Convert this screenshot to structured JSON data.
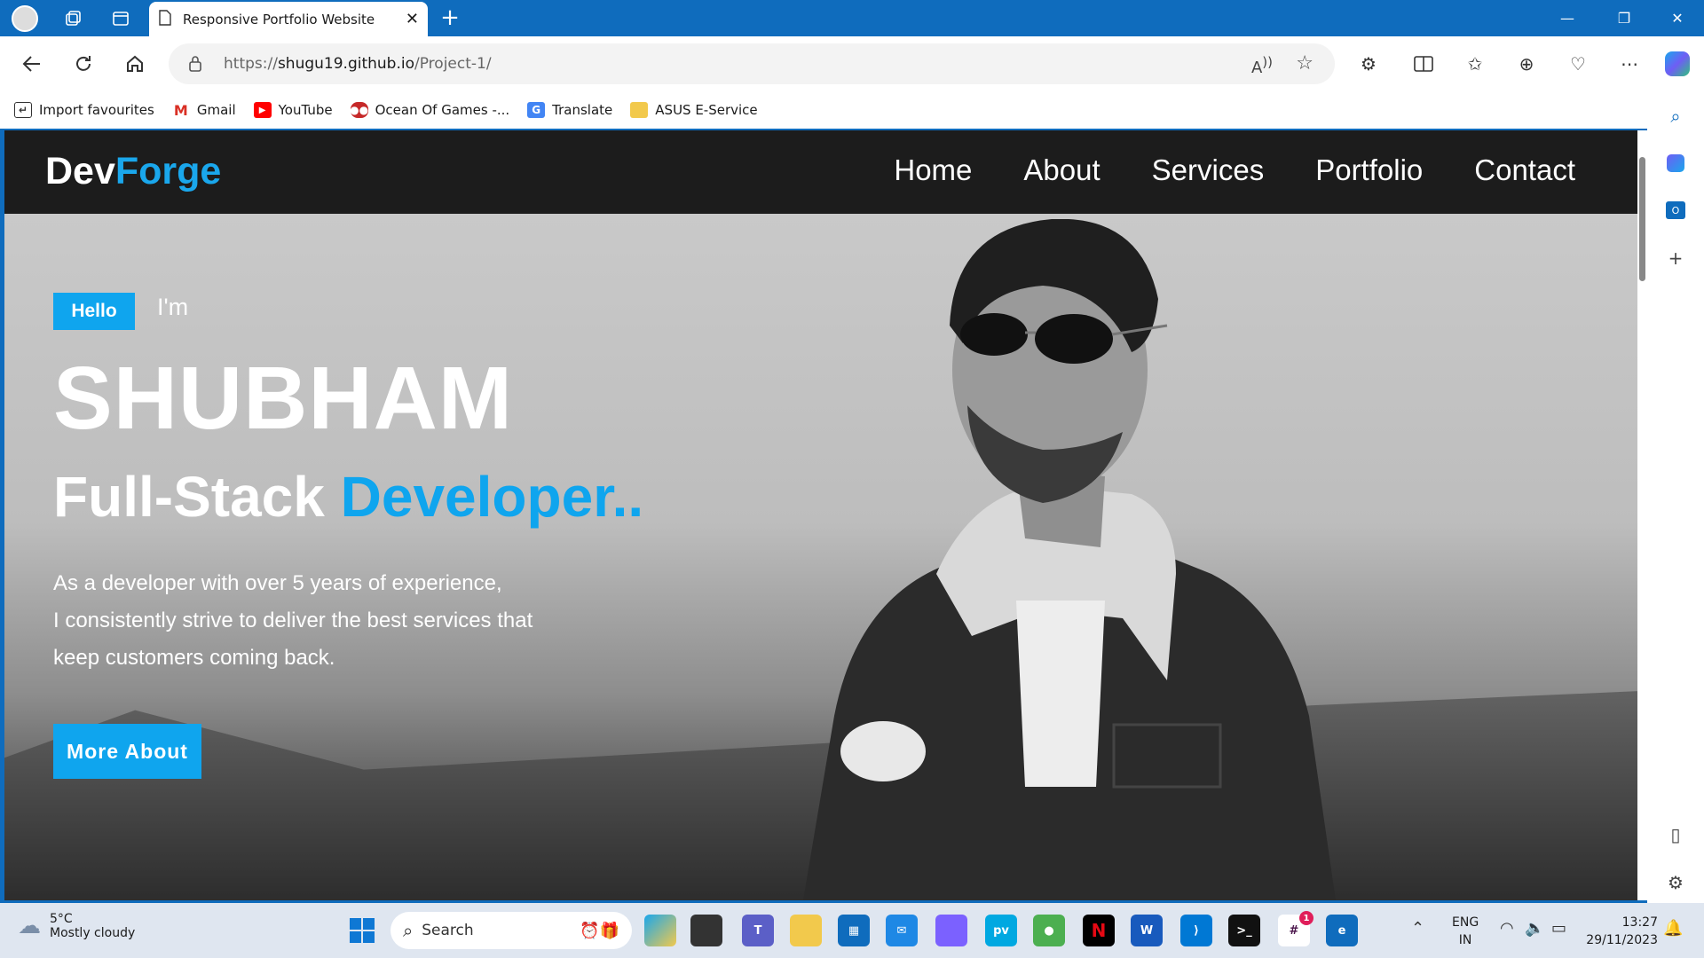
{
  "browser": {
    "tab_title": "Responsive Portfolio Website",
    "url_prefix": "https://",
    "url_host": "shugu19.github.io",
    "url_path": "/Project-1/",
    "favorites": [
      {
        "label": "Import favourites",
        "icon": "import-icon"
      },
      {
        "label": "Gmail",
        "icon": "gmail-icon",
        "color": "#d93025"
      },
      {
        "label": "YouTube",
        "icon": "youtube-icon",
        "color": "#ff0000"
      },
      {
        "label": "Ocean Of Games -...",
        "icon": "gamepad-icon",
        "color": "#c62828"
      },
      {
        "label": "Translate",
        "icon": "translate-icon",
        "color": "#4285f4"
      },
      {
        "label": "ASUS E-Service",
        "icon": "folder-icon",
        "color": "#f2c94c"
      }
    ]
  },
  "site": {
    "logo_part1": "Dev",
    "logo_part2": "Forge",
    "nav": [
      "Home",
      "About",
      "Services",
      "Portfolio",
      "Contact"
    ],
    "hello": "Hello",
    "im": "I'm",
    "name": "SHUBHAM",
    "role_plain": "Full-Stack ",
    "role_highlight": "Developer..",
    "desc_lines": [
      "As a developer with over 5 years of experience,",
      "I consistently strive to deliver the best services that",
      "keep customers coming back."
    ],
    "cta": "More About",
    "accent": "#0fa5ee"
  },
  "taskbar": {
    "weather_temp": "5°C",
    "weather_desc": "Mostly cloudy",
    "search_placeholder": "Search",
    "lang_top": "ENG",
    "lang_bottom": "IN",
    "time": "13:27",
    "date": "29/11/2023",
    "slack_badge": "1"
  }
}
